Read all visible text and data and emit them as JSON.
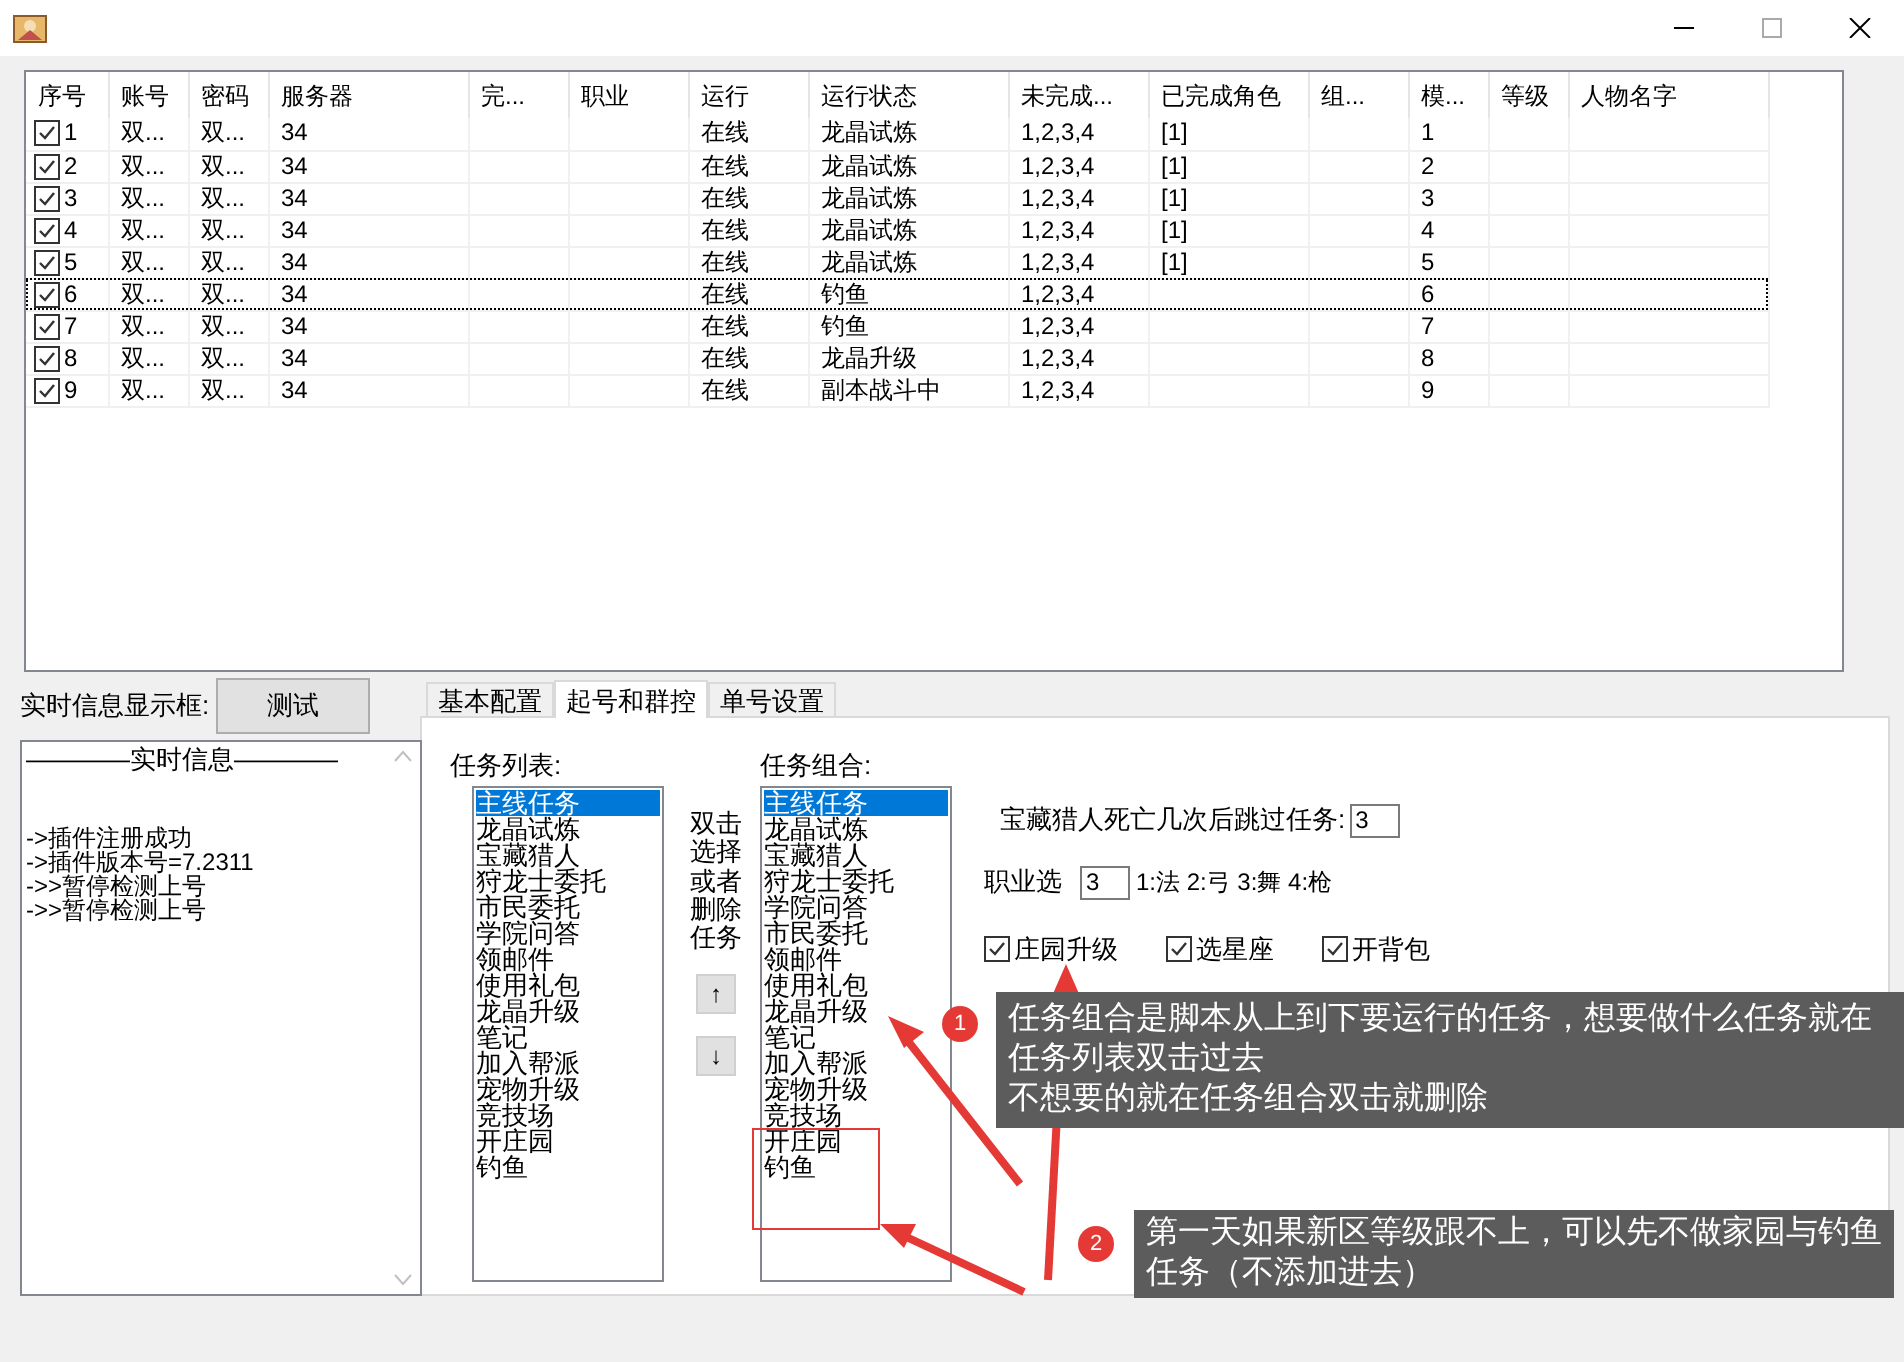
{
  "table": {
    "columns": [
      "序号",
      "账号",
      "密码",
      "服务器",
      "完...",
      "职业",
      "运行",
      "运行状态",
      "未完成...",
      "已完成角色",
      "组...",
      "模...",
      "等级",
      "人物名字"
    ],
    "rows": [
      {
        "checked": true,
        "focused": false,
        "cells": [
          "1",
          "双...",
          "双...",
          "34",
          "",
          "",
          "在线",
          "龙晶试炼",
          "1,2,3,4",
          "[1]",
          "",
          "1",
          "",
          ""
        ]
      },
      {
        "checked": true,
        "focused": false,
        "cells": [
          "2",
          "双...",
          "双...",
          "34",
          "",
          "",
          "在线",
          "龙晶试炼",
          "1,2,3,4",
          "[1]",
          "",
          "2",
          "",
          ""
        ]
      },
      {
        "checked": true,
        "focused": false,
        "cells": [
          "3",
          "双...",
          "双...",
          "34",
          "",
          "",
          "在线",
          "龙晶试炼",
          "1,2,3,4",
          "[1]",
          "",
          "3",
          "",
          ""
        ]
      },
      {
        "checked": true,
        "focused": false,
        "cells": [
          "4",
          "双...",
          "双...",
          "34",
          "",
          "",
          "在线",
          "龙晶试炼",
          "1,2,3,4",
          "[1]",
          "",
          "4",
          "",
          ""
        ]
      },
      {
        "checked": true,
        "focused": false,
        "cells": [
          "5",
          "双...",
          "双...",
          "34",
          "",
          "",
          "在线",
          "龙晶试炼",
          "1,2,3,4",
          "[1]",
          "",
          "5",
          "",
          ""
        ]
      },
      {
        "checked": true,
        "focused": true,
        "cells": [
          "6",
          "双...",
          "双...",
          "34",
          "",
          "",
          "在线",
          "钓鱼",
          "1,2,3,4",
          "",
          "",
          "6",
          "",
          ""
        ]
      },
      {
        "checked": true,
        "focused": false,
        "cells": [
          "7",
          "双...",
          "双...",
          "34",
          "",
          "",
          "在线",
          "钓鱼",
          "1,2,3,4",
          "",
          "",
          "7",
          "",
          ""
        ]
      },
      {
        "checked": true,
        "focused": false,
        "cells": [
          "8",
          "双...",
          "双...",
          "34",
          "",
          "",
          "在线",
          "龙晶升级",
          "1,2,3,4",
          "",
          "",
          "8",
          "",
          ""
        ]
      },
      {
        "checked": true,
        "focused": false,
        "cells": [
          "9",
          "双...",
          "双...",
          "34",
          "",
          "",
          "在线",
          "副本战斗中",
          "1,2,3,4",
          "",
          "",
          "9",
          "",
          ""
        ]
      }
    ]
  },
  "info_panel": {
    "label": "实时信息显示框:",
    "test_button": "测试",
    "log_heading": "————实时信息————",
    "log_lines": [
      "->插件注册成功",
      "->插件版本号=7.2311",
      "->>暂停检测上号",
      "->>暂停检测上号"
    ]
  },
  "tabs": [
    {
      "label": "基本配置",
      "selected": false
    },
    {
      "label": "起号和群控",
      "selected": true
    },
    {
      "label": "单号设置",
      "selected": false
    }
  ],
  "task_list": {
    "label": "任务列表:",
    "items": [
      {
        "text": "主线任务",
        "selected": true
      },
      {
        "text": "龙晶试炼",
        "selected": false
      },
      {
        "text": "宝藏猎人",
        "selected": false
      },
      {
        "text": "狩龙士委托",
        "selected": false
      },
      {
        "text": "市民委托",
        "selected": false
      },
      {
        "text": "学院问答",
        "selected": false
      },
      {
        "text": "领邮件",
        "selected": false
      },
      {
        "text": "使用礼包",
        "selected": false
      },
      {
        "text": "龙晶升级",
        "selected": false
      },
      {
        "text": "笔记",
        "selected": false
      },
      {
        "text": "加入帮派",
        "selected": false
      },
      {
        "text": "宠物升级",
        "selected": false
      },
      {
        "text": "竞技场",
        "selected": false
      },
      {
        "text": "开庄园",
        "selected": false
      },
      {
        "text": "钓鱼",
        "selected": false
      }
    ]
  },
  "hint": "双击选择或者删除任务",
  "move_buttons": [
    "↑",
    "↓"
  ],
  "task_combo": {
    "label": "任务组合:",
    "items": [
      {
        "text": "主线任务",
        "selected": true
      },
      {
        "text": "龙晶试炼",
        "selected": false
      },
      {
        "text": "宝藏猎人",
        "selected": false
      },
      {
        "text": "狩龙士委托",
        "selected": false
      },
      {
        "text": "学院问答",
        "selected": false
      },
      {
        "text": "市民委托",
        "selected": false
      },
      {
        "text": "领邮件",
        "selected": false
      },
      {
        "text": "使用礼包",
        "selected": false
      },
      {
        "text": "龙晶升级",
        "selected": false
      },
      {
        "text": "笔记",
        "selected": false
      },
      {
        "text": "加入帮派",
        "selected": false
      },
      {
        "text": "宠物升级",
        "selected": false
      },
      {
        "text": "竞技场",
        "selected": false
      },
      {
        "text": "开庄园",
        "selected": false
      },
      {
        "text": "钓鱼",
        "selected": false
      }
    ]
  },
  "settings": {
    "death_label": "宝藏猎人死亡几次后跳过任务:",
    "death_value": "3",
    "class_label": "职业选",
    "class_value": "3",
    "class_legend": "1:法 2:弓 3:舞 4:枪",
    "checkboxes": [
      {
        "label": "庄园升级",
        "checked": true
      },
      {
        "label": "选星座",
        "checked": true
      },
      {
        "label": "开背包",
        "checked": true
      }
    ]
  },
  "annotations": [
    {
      "number": "1",
      "lines": [
        "任务组合是脚本从上到下要运行的任务，想要做什么任务就在任务列表双击过去",
        "不想要的就在任务组合双击就删除"
      ]
    },
    {
      "number": "2",
      "lines": [
        "第一天如果新区等级跟不上，可以先不做家园与钓鱼任务（不添加进去）"
      ]
    }
  ]
}
